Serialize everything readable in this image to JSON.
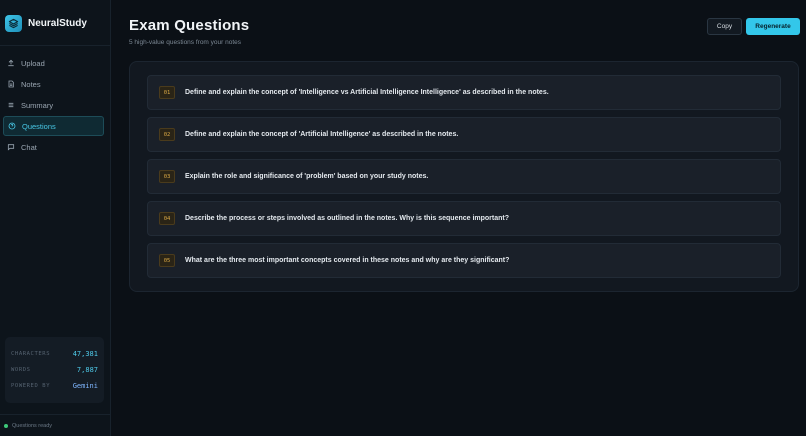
{
  "brand": {
    "name": "NeuralStudy"
  },
  "nav": [
    {
      "label": "Upload",
      "icon": "upload-icon"
    },
    {
      "label": "Notes",
      "icon": "file-icon"
    },
    {
      "label": "Summary",
      "icon": "list-icon"
    },
    {
      "label": "Questions",
      "icon": "help-circle-icon",
      "active": true
    },
    {
      "label": "Chat",
      "icon": "chat-icon"
    }
  ],
  "stats": [
    {
      "label": "CHARACTERS",
      "value": "47,381"
    },
    {
      "label": "WORDS",
      "value": "7,887"
    },
    {
      "label": "POWERED BY",
      "value": "Gemini"
    }
  ],
  "status": {
    "text": "Questions ready"
  },
  "header": {
    "title": "Exam Questions",
    "subtitle": "5 high-value questions from your notes",
    "copy_label": "Copy",
    "regenerate_label": "Regenerate"
  },
  "questions": [
    {
      "num": "01",
      "text": "Define and explain the concept of 'Intelligence vs Artificial Intelligence Intelligence' as described in the notes."
    },
    {
      "num": "02",
      "text": "Define and explain the concept of 'Artificial Intelligence' as described in the notes."
    },
    {
      "num": "03",
      "text": "Explain the role and significance of 'problem' based on your study notes."
    },
    {
      "num": "04",
      "text": "Describe the process or steps involved as outlined in the notes. Why is this sequence important?"
    },
    {
      "num": "05",
      "text": "What are the three most important concepts covered in these notes and why are they significant?"
    }
  ],
  "colors": {
    "accent": "#33c7ea",
    "background": "#0b1016",
    "number_badge": "#d9a845",
    "status_dot": "#3ec97a"
  }
}
